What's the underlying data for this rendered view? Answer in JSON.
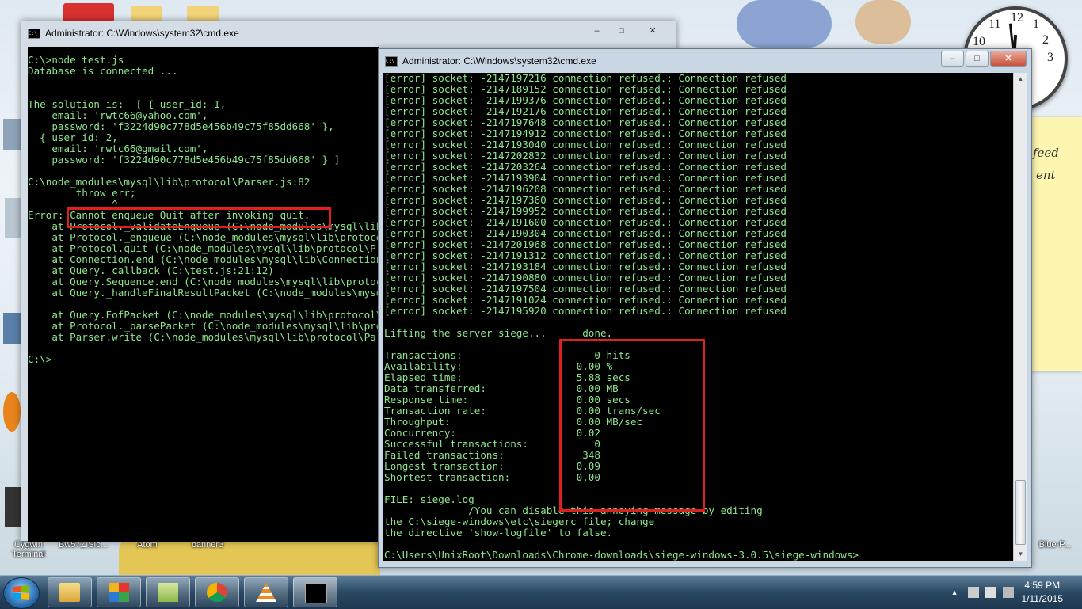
{
  "desktop": {
    "icons": [
      {
        "label": "Cygwin Terminal"
      },
      {
        "label": "Bw57ZISlc..."
      },
      {
        "label": "Atom"
      },
      {
        "label": "banner3"
      },
      {
        "label": "Blue-P..."
      }
    ],
    "sticky_lines": [
      "feed",
      "ent"
    ],
    "clock_numbers": [
      "10",
      "11",
      "12",
      "1",
      "2",
      "3"
    ]
  },
  "window_back": {
    "title": "Administrator: C:\\Windows\\system32\\cmd.exe",
    "lines": [
      "C:\\>node test.js",
      "Database is connected ...",
      "",
      "",
      "The solution is:  [ { user_id: 1,",
      "    email: 'rwtc66@yahoo.com',",
      "    password: 'f3224d90c778d5e456b49c75f85dd668' },",
      "  { user_id: 2,",
      "    email: 'rwtc66@gmail.com',",
      "    password: 'f3224d90c778d5e456b49c75f85dd668' } ]",
      "",
      "C:\\node_modules\\mysql\\lib\\protocol\\Parser.js:82",
      "        throw err;",
      "              ^",
      "Error: Cannot enqueue Quit after invoking quit.",
      "    at Protocol._validateEnqueue (C:\\node_modules\\mysql\\lib\\protocol\\Protocol.js:",
      "    at Protocol._enqueue (C:\\node_modules\\mysql\\lib\\protocol\\Protocol.js:",
      "    at Protocol.quit (C:\\node_modules\\mysql\\lib\\protocol\\Protocol.js:",
      "    at Connection.end (C:\\node_modules\\mysql\\lib\\Connection.js:",
      "    at Query._callback (C:\\test.js:21:12)",
      "    at Query.Sequence.end (C:\\node_modules\\mysql\\lib\\protocol\\sequences",
      "    at Query._handleFinalResultPacket (C:\\node_modules\\mysql\\lib\\protocol",
      "",
      "    at Query.EofPacket (C:\\node_modules\\mysql\\lib\\protocol\\sequences",
      "    at Protocol._parsePacket (C:\\node_modules\\mysql\\lib\\protocol\\Protocol.js",
      "    at Parser.write (C:\\node_modules\\mysql\\lib\\protocol\\Parser.js",
      "",
      "C:\\>"
    ]
  },
  "window_front": {
    "title": "Administrator: C:\\Windows\\system32\\cmd.exe",
    "error_lines": [
      "[error] socket: -2147197216 connection refused.: Connection refused",
      "[error] socket: -2147189152 connection refused.: Connection refused",
      "[error] socket: -2147199376 connection refused.: Connection refused",
      "[error] socket: -2147192176 connection refused.: Connection refused",
      "[error] socket: -2147197648 connection refused.: Connection refused",
      "[error] socket: -2147194912 connection refused.: Connection refused",
      "[error] socket: -2147193040 connection refused.: Connection refused",
      "[error] socket: -2147202832 connection refused.: Connection refused",
      "[error] socket: -2147203264 connection refused.: Connection refused",
      "[error] socket: -2147193904 connection refused.: Connection refused",
      "[error] socket: -2147196208 connection refused.: Connection refused",
      "[error] socket: -2147197360 connection refused.: Connection refused",
      "[error] socket: -2147199952 connection refused.: Connection refused",
      "[error] socket: -2147191600 connection refused.: Connection refused",
      "[error] socket: -2147190304 connection refused.: Connection refused",
      "[error] socket: -2147201968 connection refused.: Connection refused",
      "[error] socket: -2147191312 connection refused.: Connection refused",
      "[error] socket: -2147193184 connection refused.: Connection refused",
      "[error] socket: -2147190880 connection refused.: Connection refused",
      "[error] socket: -2147197504 connection refused.: Connection refused",
      "[error] socket: -2147191024 connection refused.: Connection refused",
      "[error] socket: -2147195920 connection refused.: Connection refused"
    ],
    "lines": [
      "",
      "Lifting the server siege...      done.",
      "",
      "Transactions:                      0 hits",
      "Availability:                   0.00 %",
      "Elapsed time:                   5.88 secs",
      "Data transferred:               0.00 MB",
      "Response time:                  0.00 secs",
      "Transaction rate:               0.00 trans/sec",
      "Throughput:                     0.00 MB/sec",
      "Concurrency:                    0.02",
      "Successful transactions:           0",
      "Failed transactions:             348",
      "Longest transaction:            0.09",
      "Shortest transaction:           0.00",
      "",
      "FILE: siege.log",
      "              /You can disable this annoying message by editing",
      "the C:\\siege-windows\\etc\\siegerc file; change",
      "the directive 'show-logfile' to false.",
      "",
      "C:\\Users\\UnixRoot\\Downloads\\Chrome-downloads\\siege-windows-3.0.5\\siege-windows>"
    ]
  },
  "taskbar": {
    "time": "4:59 PM",
    "date": "1/11/2015",
    "buttons": [
      "windows-explorer",
      "metro-app",
      "folder",
      "chrome",
      "vlc",
      "cmd"
    ]
  },
  "colors": {
    "console_text": "#c0c0c0",
    "console_green": "#8ee68e",
    "highlight_red": "#e0201e"
  }
}
